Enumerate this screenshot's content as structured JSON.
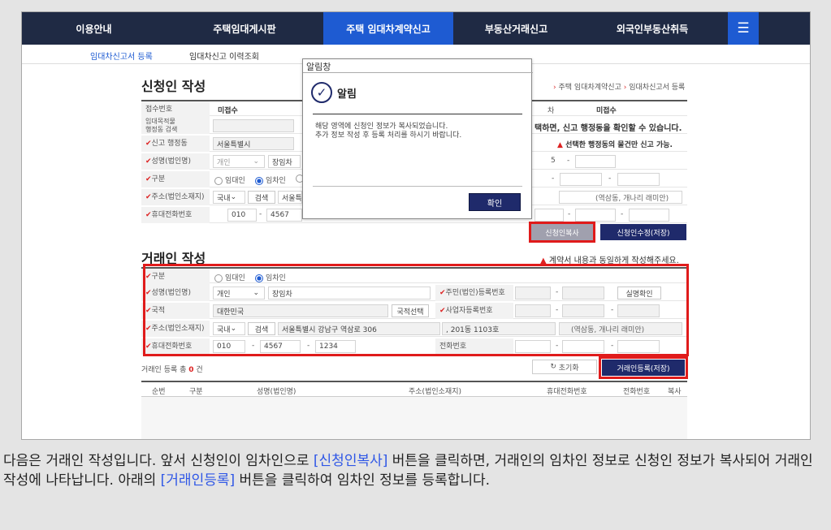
{
  "nav": {
    "items": [
      "이용안내",
      "주택임대게시판",
      "주택 임대차계약신고",
      "부동산거래신고",
      "외국인부동산취득"
    ],
    "active_index": 2,
    "menu_icon": "hamburger-menu-icon"
  },
  "subnav": {
    "items": [
      "임대차신고서 등록",
      "임대차신고 이력조회"
    ],
    "active_index": 0
  },
  "applicant": {
    "title": "신청인 작성",
    "breadcrumb": [
      "주택 임대차계약신고",
      "임대차신고서 등록"
    ],
    "receipt_label": "접수번호",
    "receipt_value": "미접수",
    "receipt_label_right": "차",
    "receipt_value_right": "미접수",
    "lease_office_label": "임대목적물\n행정동 검색",
    "lease_office_msg": "택하면, 신고 행정동을 확인할 수 있습니다.",
    "office_label": "신고 행정동",
    "office_value": "서울특별시",
    "office_warn": "선택한 행정동의 물건만 신고 가능.",
    "name_label": "성명(법인명)",
    "name_type": "개인",
    "name_value": "장임차",
    "name_right_field": "5",
    "type_label": "구분",
    "type_options": [
      "임대인",
      "임차인"
    ],
    "type_selected": 1,
    "address_label": "주소(법인소재지)",
    "address_scope": "국내",
    "address_search": "검색",
    "address_value": "서울특",
    "address_note": "(역삼동, 개나리 래미안)",
    "phone_label": "휴대전화번호",
    "phone": [
      "010",
      "4567"
    ],
    "copy_button": "신청인복사",
    "edit_button": "신청인수정(저장)"
  },
  "trader": {
    "title": "거래인 작성",
    "warn": "계약서 내용과 동일하게 작성해주세요.",
    "type_label": "구분",
    "type_options": [
      "임대인",
      "임차인"
    ],
    "type_selected": 1,
    "name_label": "성명(법인명)",
    "name_type": "개인",
    "name_value": "장임차",
    "resident_label": "주민(법인)등록번호",
    "verify_button": "실명확인",
    "nation_label": "국적",
    "nation_value": "대한민국",
    "nation_button": "국적선택",
    "biz_label": "사업자등록번호",
    "address_label": "주소(법인소재지)",
    "address_scope": "국내",
    "address_search": "검색",
    "address_value": "서울특별시 강남구 역삼로 306",
    "address_detail": ", 201동 1103호",
    "address_note": "(역삼동, 개나리 래미안)",
    "phone_label": "휴대전화번호",
    "phone": [
      "010",
      "4567",
      "1234"
    ],
    "tel_label": "전화번호",
    "count_prefix": "거래인 등록 총",
    "count_value": "0",
    "count_suffix": "건",
    "reset_button": "초기화",
    "register_button": "거래인등록(저장)",
    "columns": [
      "순번",
      "구분",
      "성명(법인명)",
      "주소(법인소재지)",
      "휴대전화번호",
      "전화번호",
      "복사"
    ]
  },
  "modal": {
    "window_title": "알림창",
    "heading": "알림",
    "message_line1": "해당 영역에 신청인 정보가 복사되었습니다.",
    "message_line2": "추가 정보 작성 후 등록 처리를 하시기 바랍니다.",
    "confirm_button": "확인"
  },
  "caption": {
    "part1": "다음은 거래인 작성입니다. 앞서 신청인이 임차인으로 ",
    "highlight1": "[신청인복사]",
    "part2": " 버튼을 클릭하면, 거래인의 임차인 정보로 신청인 정보가 복사되어 거래인 작성에 나타납니다. 아래의 ",
    "highlight2": "[거래인등록]",
    "part3": " 버튼을 클릭하여 임차인 정보를 등록합니다."
  },
  "colors": {
    "nav_bg": "#1f2a44",
    "nav_active": "#1e5bd2",
    "highlight_box": "#e01b1b",
    "button_dark": "#1f2a6b",
    "caption_link": "#2e56e6"
  }
}
